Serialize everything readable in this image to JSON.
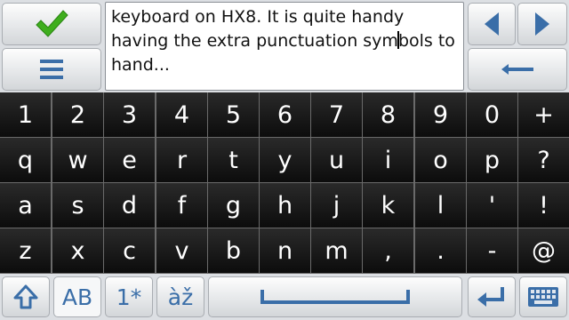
{
  "editor": {
    "text_before_caret": "keyboard on HX8. It is quite handy having the extra punctuation sym",
    "text_after_caret": "bols to hand..."
  },
  "toolbar": {
    "confirm_icon": "checkmark-icon",
    "menu_icon": "menu-icon",
    "left_icon": "arrow-left-icon",
    "right_icon": "arrow-right-icon",
    "backspace_icon": "backspace-icon"
  },
  "keyboard": {
    "rows": [
      [
        "1",
        "2",
        "3",
        "4",
        "5",
        "6",
        "7",
        "8",
        "9",
        "0",
        "+"
      ],
      [
        "q",
        "w",
        "e",
        "r",
        "t",
        "y",
        "u",
        "i",
        "o",
        "p",
        "?"
      ],
      [
        "a",
        "s",
        "d",
        "f",
        "g",
        "h",
        "j",
        "k",
        "l",
        "'",
        "!"
      ],
      [
        "z",
        "x",
        "c",
        "v",
        "b",
        "n",
        "m",
        ",",
        ".",
        "-",
        "@"
      ]
    ]
  },
  "bottom_bar": {
    "case_label": "AB",
    "symbols_label": "1*",
    "accents_label": "àž"
  },
  "colors": {
    "accent": "#3a6ea8",
    "confirm_green": "#3fae1e",
    "key_bg": "#151515",
    "panel_bg": "#dcdfe3"
  }
}
